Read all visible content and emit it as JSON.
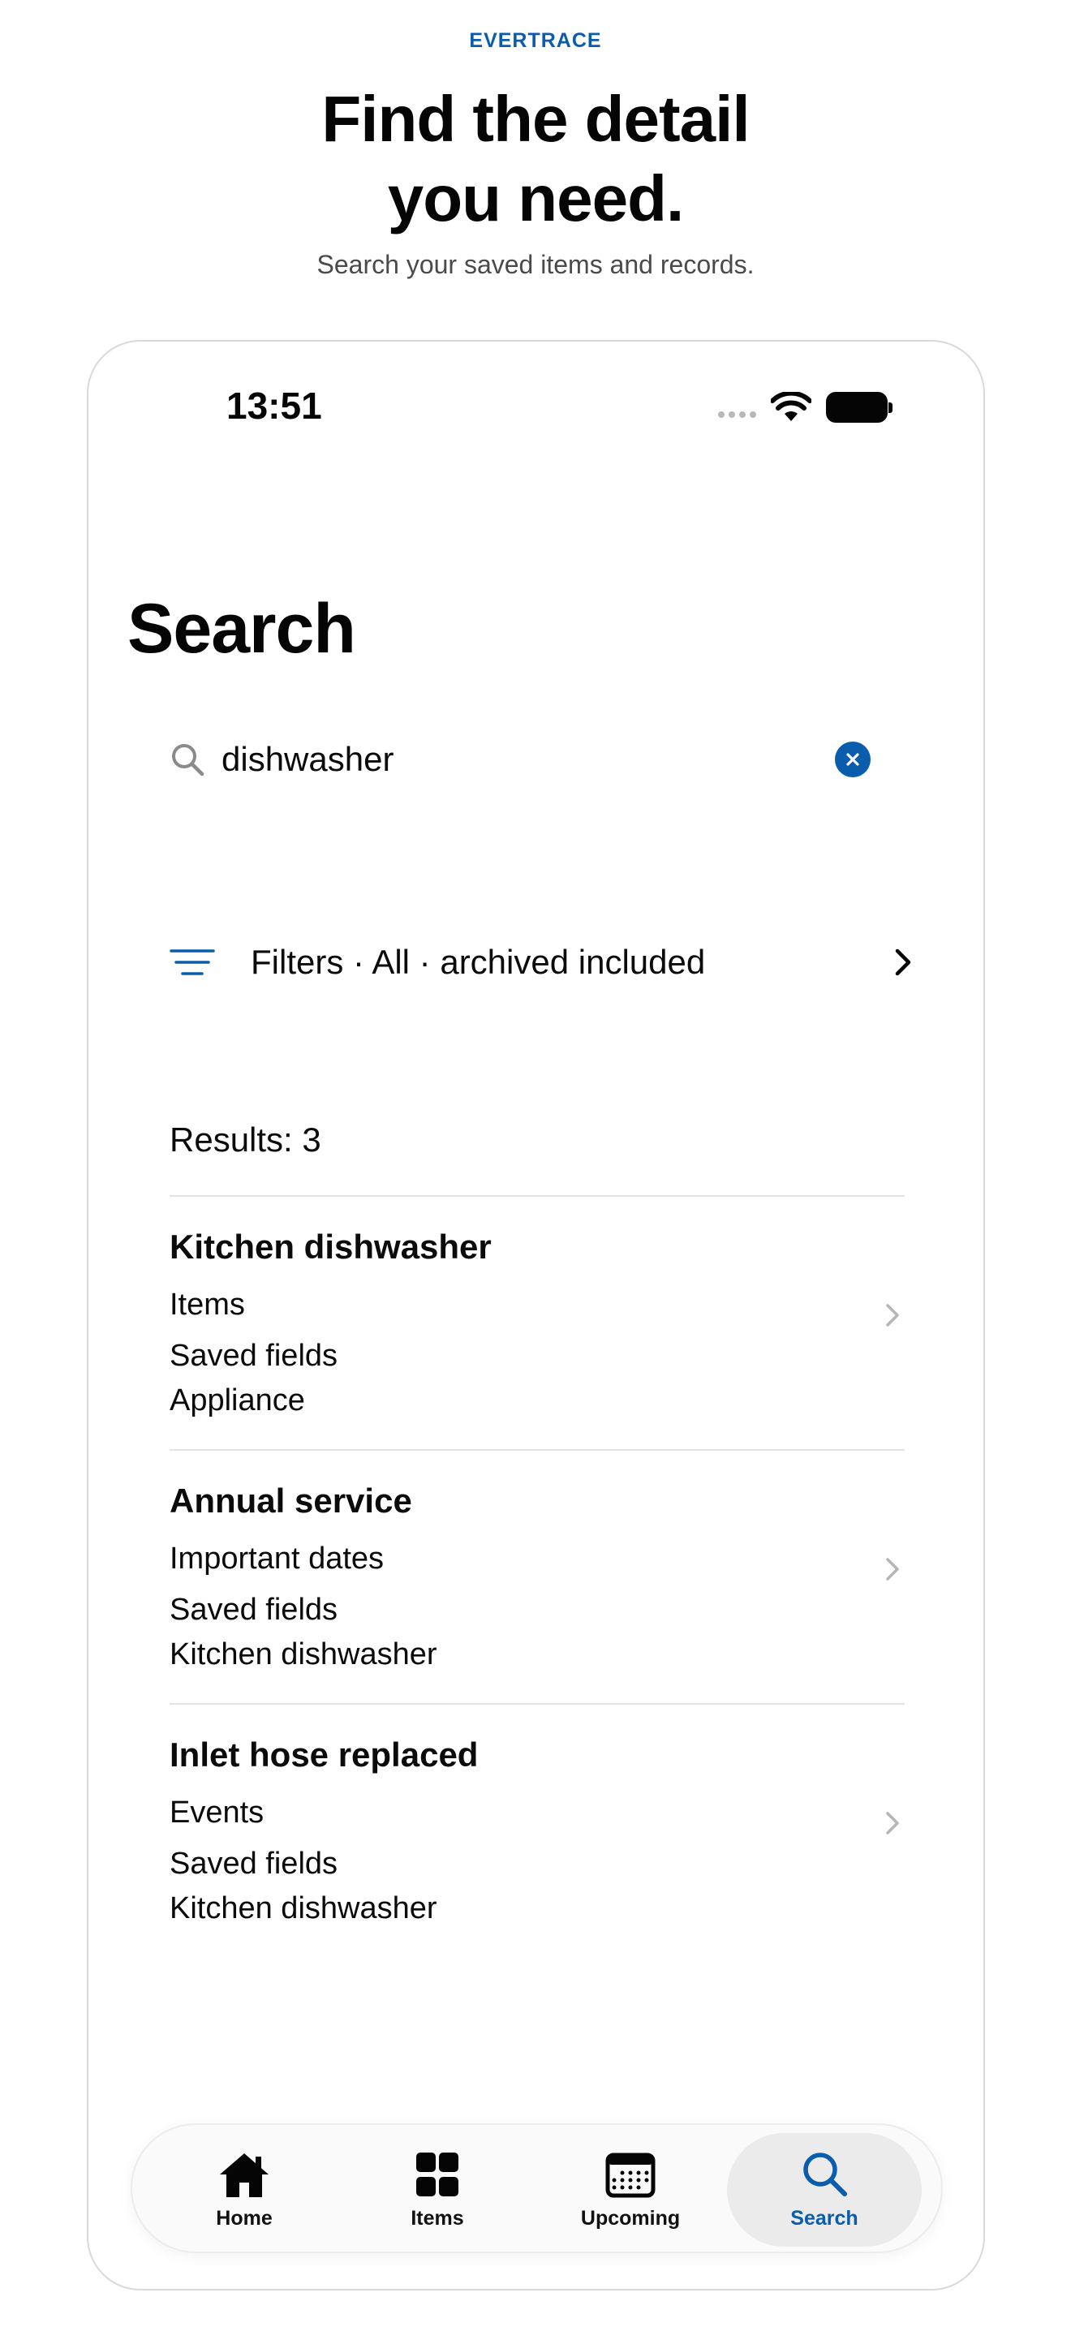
{
  "marketing": {
    "brand": "EVERTRACE",
    "headline_line1": "Find the detail",
    "headline_line2": "you need.",
    "subhead": "Search your saved items and records."
  },
  "status_bar": {
    "time": "13:51"
  },
  "screen": {
    "title": "Search"
  },
  "search": {
    "query": "dishwasher"
  },
  "filters": {
    "label": "Filters · All · archived included"
  },
  "results": {
    "count_label": "Results: 3",
    "items": [
      {
        "title": "Kitchen dishwasher",
        "category": "Items",
        "kind": "Saved fields",
        "reference": "Appliance"
      },
      {
        "title": "Annual service",
        "category": "Important dates",
        "kind": "Saved fields",
        "reference": "Kitchen dishwasher"
      },
      {
        "title": "Inlet hose replaced",
        "category": "Events",
        "kind": "Saved fields",
        "reference": "Kitchen dishwasher"
      }
    ]
  },
  "tab_bar": {
    "tabs": [
      {
        "label": "Home",
        "icon": "house-icon"
      },
      {
        "label": "Items",
        "icon": "grid-icon"
      },
      {
        "label": "Upcoming",
        "icon": "calendar-icon"
      },
      {
        "label": "Search",
        "icon": "magnifier-icon"
      }
    ],
    "active": "Search"
  },
  "colors": {
    "accent": "#0a5cad",
    "text": "#0b0b0b",
    "secondary_text": "#4a4a4a",
    "divider": "#e3e3e3",
    "chevron_muted": "#b5b5b5"
  }
}
